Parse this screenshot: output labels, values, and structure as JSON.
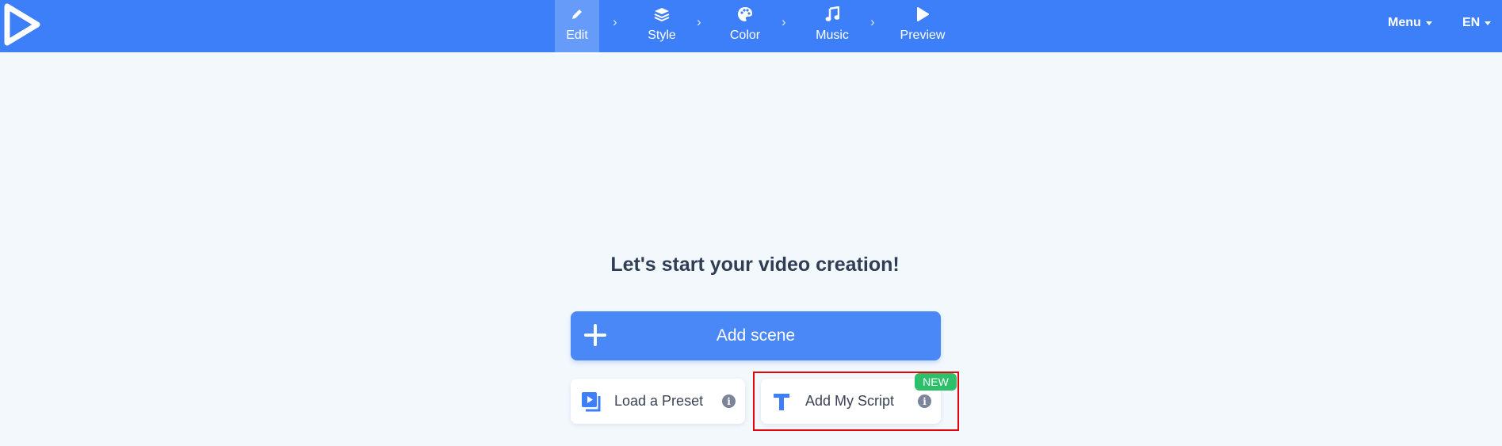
{
  "topbar": {
    "steps": [
      {
        "label": "Edit",
        "icon": "pencil-icon",
        "active": true
      },
      {
        "label": "Style",
        "icon": "layers-icon",
        "active": false
      },
      {
        "label": "Color",
        "icon": "palette-icon",
        "active": false
      },
      {
        "label": "Music",
        "icon": "music-note-icon",
        "active": false
      },
      {
        "label": "Preview",
        "icon": "play-icon",
        "active": false
      }
    ],
    "menu_label": "Menu",
    "language_label": "EN"
  },
  "main": {
    "heading": "Let's start your video creation!",
    "add_scene_label": "Add scene",
    "load_preset_label": "Load a Preset",
    "add_script_label": "Add My Script",
    "new_badge": "NEW"
  },
  "colors": {
    "topbar": "#3d7ff8",
    "primary_button": "#4a88f7",
    "badge": "#2dbf6a",
    "highlight": "#e8000b"
  }
}
